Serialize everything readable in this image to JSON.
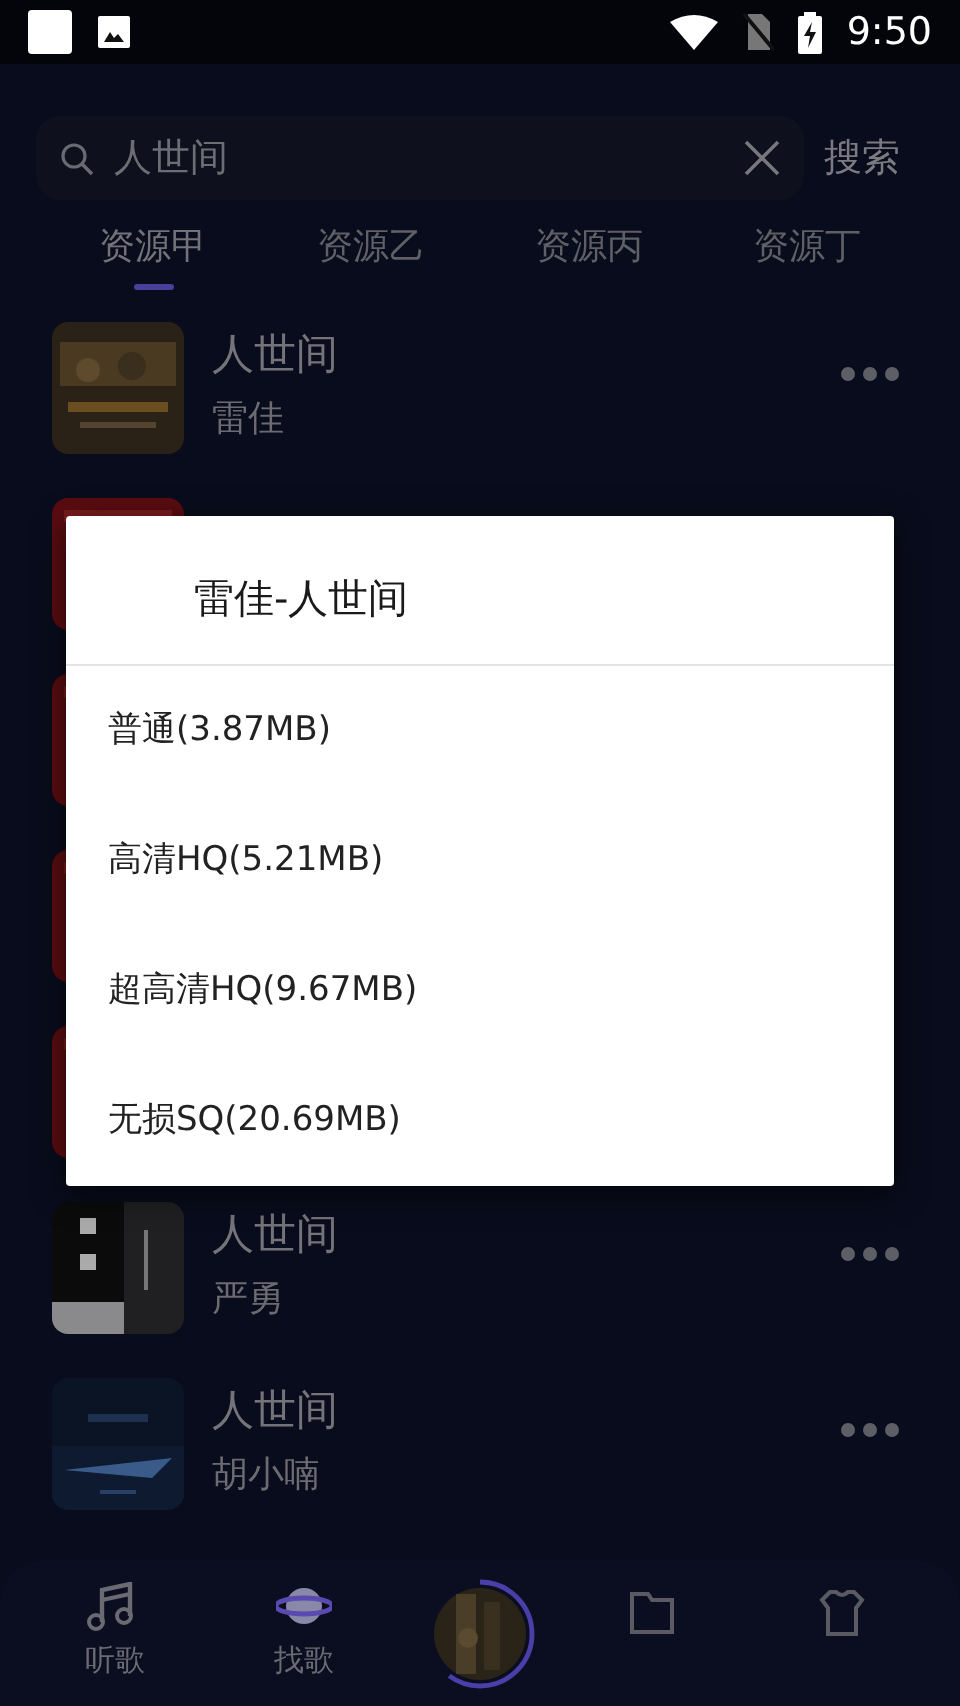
{
  "status_bar": {
    "time": "9:50"
  },
  "search": {
    "value": "人世间",
    "button": "搜索"
  },
  "tabs": [
    {
      "label": "资源甲",
      "selected": true
    },
    {
      "label": "资源乙",
      "selected": false
    },
    {
      "label": "资源丙",
      "selected": false
    },
    {
      "label": "资源丁",
      "selected": false
    }
  ],
  "songs": [
    {
      "kind": "song",
      "title": "人世间",
      "artist": "雷佳"
    },
    {
      "kind": "covered"
    },
    {
      "kind": "covered"
    },
    {
      "kind": "covered"
    },
    {
      "kind": "covered"
    },
    {
      "kind": "song",
      "title": "人世间",
      "artist": "严勇"
    },
    {
      "kind": "song",
      "title": "人世间",
      "artist": "胡小喃"
    }
  ],
  "dialog": {
    "title": "雷佳-人世间",
    "options": [
      "普通(3.87MB)",
      "高清HQ(5.21MB)",
      "超高清HQ(9.67MB)",
      "无损SQ(20.69MB)"
    ]
  },
  "bottom_nav": [
    {
      "kind": "tab",
      "label": "听歌"
    },
    {
      "kind": "tab",
      "label": "找歌"
    },
    {
      "kind": "player",
      "level": 0.6
    },
    {
      "kind": "tab"
    },
    {
      "kind": "tab"
    }
  ]
}
